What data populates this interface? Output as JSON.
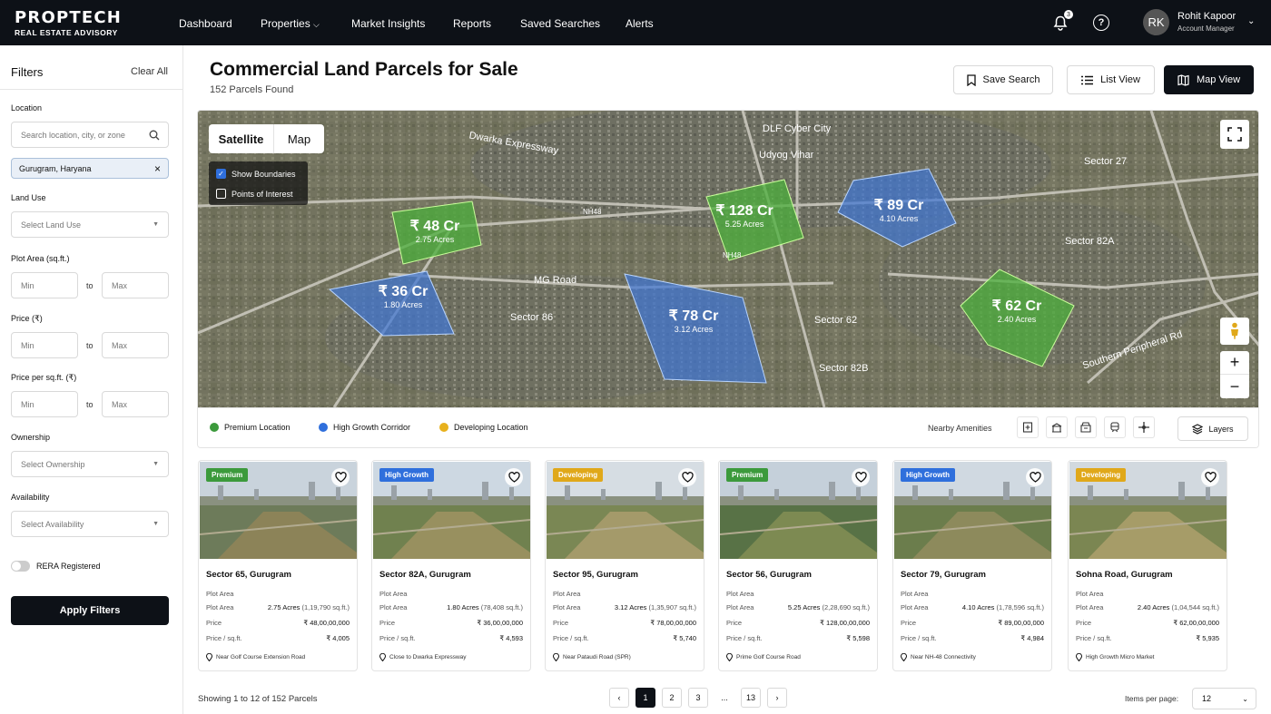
{
  "brand": {
    "line1": "PROPTECH",
    "line2": "REAL ESTATE ADVISORY"
  },
  "nav": {
    "links": [
      "Dashboard",
      "Properties",
      "Market Insights",
      "Reports",
      "Saved Searches",
      "Alerts"
    ],
    "notif_count": "3",
    "user_initials": "RK",
    "user_name": "Rohit Kapoor",
    "user_role": "Account Manager"
  },
  "sidebar": {
    "title": "Filters",
    "clear": "Clear All",
    "location_label": "Location",
    "location_placeholder": "Search location, city, or zone",
    "location_chip": "Gurugram, Haryana",
    "land_use_label": "Land Use",
    "land_use_placeholder": "Select Land Use",
    "plot_area_label": "Plot Area (sq.ft.)",
    "price_label": "Price (₹)",
    "ppsf_label": "Price per sq.ft. (₹)",
    "min": "Min",
    "max": "Max",
    "to": "to",
    "ownership_label": "Ownership",
    "ownership_placeholder": "Select Ownership",
    "availability_label": "Availability",
    "availability_placeholder": "Select Availability",
    "rera": "RERA Registered",
    "apply": "Apply Filters"
  },
  "header": {
    "title": "Commercial Land Parcels for Sale",
    "subtitle": "152 Parcels Found",
    "save_search": "Save Search",
    "list_view": "List View",
    "map_view": "Map View"
  },
  "map": {
    "tab_satellite": "Satellite",
    "tab_map": "Map",
    "show_boundaries": "Show Boundaries",
    "poi": "Points of Interest",
    "labels": [
      "DLF Cyber City",
      "Udyog Vihar",
      "Sector 27",
      "Sector 82A",
      "MG Road",
      "Sector 86",
      "Sector 62",
      "Dwarka Expressway",
      "Sector 82B",
      "Southern Peripheral Rd",
      "NH48",
      "NH48"
    ],
    "parcels": [
      {
        "price": "₹ 48 Cr",
        "area": "2.75 Acres",
        "color": "green"
      },
      {
        "price": "₹ 128 Cr",
        "area": "5.25 Acres",
        "color": "green"
      },
      {
        "price": "₹ 89 Cr",
        "area": "4.10 Acres",
        "color": "blue"
      },
      {
        "price": "₹ 36 Cr",
        "area": "1.80 Acres",
        "color": "blue"
      },
      {
        "price": "₹ 78 Cr",
        "area": "3.12 Acres",
        "color": "blue"
      },
      {
        "price": "₹ 62 Cr",
        "area": "2.40 Acres",
        "color": "green"
      }
    ],
    "legend": [
      {
        "label": "Premium Location",
        "color": "#3c9a3c"
      },
      {
        "label": "High Growth Corridor",
        "color": "#2f6fdc"
      },
      {
        "label": "Developing Location",
        "color": "#e8b11d"
      }
    ],
    "nearby": "Nearby Amenities",
    "layers": "Layers"
  },
  "labels": {
    "plot_area": "Plot Area",
    "price": "Price",
    "ppsf": "Price / sq.ft."
  },
  "cards": [
    {
      "tag": "Premium",
      "tagcolor": "#3c9a3c",
      "title": "Sector 65, Gurugram",
      "acres": "2.75 Acres",
      "sqft": "(1,19,790 sq.ft.)",
      "price": "₹ 48,00,00,000",
      "ppsf": "₹ 4,005",
      "note": "Near Golf Course Extension Road"
    },
    {
      "tag": "High Growth",
      "tagcolor": "#2f6fdc",
      "title": "Sector 82A, Gurugram",
      "acres": "1.80 Acres",
      "sqft": "(78,408 sq.ft.)",
      "price": "₹ 36,00,00,000",
      "ppsf": "₹ 4,593",
      "note": "Close to Dwarka Expressway"
    },
    {
      "tag": "Developing",
      "tagcolor": "#e0a81a",
      "title": "Sector 95, Gurugram",
      "acres": "3.12 Acres",
      "sqft": "(1,35,907 sq.ft.)",
      "price": "₹ 78,00,00,000",
      "ppsf": "₹ 5,740",
      "note": "Near Pataudi Road (SPR)"
    },
    {
      "tag": "Premium",
      "tagcolor": "#3c9a3c",
      "title": "Sector 56, Gurugram",
      "acres": "5.25 Acres",
      "sqft": "(2,28,690 sq.ft.)",
      "price": "₹ 128,00,00,000",
      "ppsf": "₹ 5,598",
      "note": "Prime Golf Course Road"
    },
    {
      "tag": "High Growth",
      "tagcolor": "#2f6fdc",
      "title": "Sector 79, Gurugram",
      "acres": "4.10 Acres",
      "sqft": "(1,78,596 sq.ft.)",
      "price": "₹ 89,00,00,000",
      "ppsf": "₹ 4,984",
      "note": "Near NH-48 Connectivity"
    },
    {
      "tag": "Developing",
      "tagcolor": "#e0a81a",
      "title": "Sohna Road, Gurugram",
      "acres": "2.40 Acres",
      "sqft": "(1,04,544 sq.ft.)",
      "price": "₹ 62,00,00,000",
      "ppsf": "₹ 5,935",
      "note": "High Growth Micro Market"
    }
  ],
  "footer": {
    "showing": "Showing 1 to 12 of 152 Parcels",
    "pages": [
      "1",
      "2",
      "3",
      "...",
      "13"
    ],
    "per_page_label": "Items per page:",
    "per_page": "12"
  }
}
